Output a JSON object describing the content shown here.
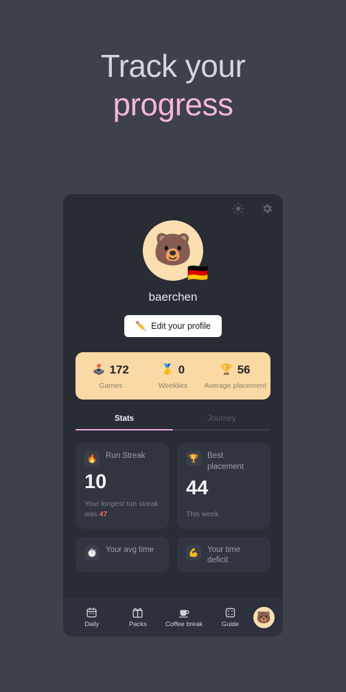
{
  "headline": {
    "line1": "Track your",
    "line2": "progress",
    "line1_color": "#d3d6dc",
    "line2_color": "#f7b4dd"
  },
  "colors": {
    "page_background": "#3c414a",
    "card_background": "#282c35",
    "stats_bar": "#fbd9a4",
    "accent_pink": "#efa8e0",
    "highlight_red": "#ef6b6b",
    "avatar_bg": "#fbdfb0",
    "nav_background": "#2c313b"
  },
  "topbar": {
    "theme_icon": "sun-icon",
    "settings_icon": "gear-icon"
  },
  "profile": {
    "avatar_icon": "bear-avatar",
    "avatar_glyph": "🐻",
    "flag_icon": "germany-flag",
    "flag_glyph": "🇩🇪",
    "username": "baerchen",
    "edit_button_label": "Edit your profile",
    "edit_button_icon": "pencil-icon",
    "edit_button_glyph": "✏️"
  },
  "stats_bar": [
    {
      "icon": "joystick-icon",
      "glyph": "🕹️",
      "value": "172",
      "label": "Games"
    },
    {
      "icon": "medal-icon",
      "glyph": "🥇",
      "value": "0",
      "label": "Weeklies"
    },
    {
      "icon": "trophy-icon",
      "glyph": "🏆",
      "value": "56",
      "label": "Average placement"
    }
  ],
  "tabs": {
    "items": [
      {
        "label": "Stats",
        "active": true
      },
      {
        "label": "Journey",
        "active": false
      }
    ]
  },
  "stat_cards": [
    {
      "icon": "fire-icon",
      "glyph": "🔥",
      "title": "Run Streak",
      "value": "10",
      "footer_prefix": "Your longest run streak was ",
      "footer_highlight": "47"
    },
    {
      "icon": "trophy-icon",
      "glyph": "🏆",
      "title": "Best placement",
      "value": "44",
      "footer_prefix": "This week",
      "footer_highlight": ""
    },
    {
      "icon": "stopwatch-icon",
      "glyph": "⏱️",
      "title": "Your avg time",
      "value": "",
      "footer_prefix": "",
      "footer_highlight": ""
    },
    {
      "icon": "flexed-biceps-icon",
      "glyph": "💪",
      "title": "Your time deficit",
      "value": "",
      "footer_prefix": "",
      "footer_highlight": ""
    }
  ],
  "bottom_nav": {
    "items": [
      {
        "label": "Daily",
        "icon": "calendar-icon"
      },
      {
        "label": "Packs",
        "icon": "packs-icon"
      },
      {
        "label": "Coffee break",
        "icon": "coffee-cup-icon"
      },
      {
        "label": "Guide",
        "icon": "dice-icon"
      }
    ],
    "avatar": {
      "icon": "bear-avatar-button",
      "glyph": "🐻"
    }
  }
}
